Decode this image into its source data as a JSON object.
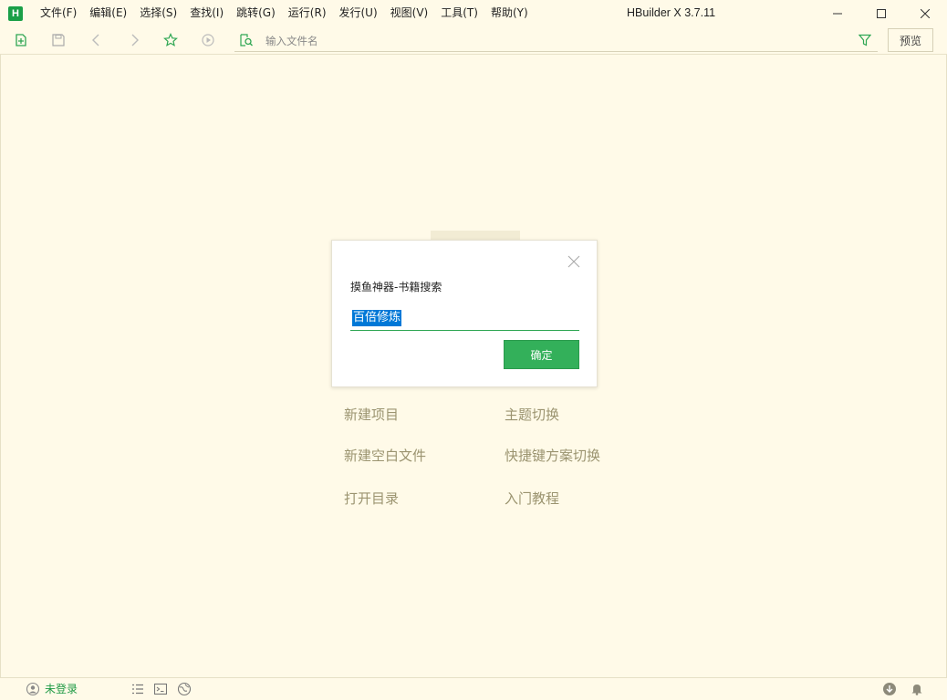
{
  "app": {
    "logo_letter": "H",
    "window_title": "HBuilder X 3.7.11"
  },
  "menu": [
    {
      "label": "文件(F)"
    },
    {
      "label": "编辑(E)"
    },
    {
      "label": "选择(S)"
    },
    {
      "label": "查找(I)"
    },
    {
      "label": "跳转(G)"
    },
    {
      "label": "运行(R)"
    },
    {
      "label": "发行(U)"
    },
    {
      "label": "视图(V)"
    },
    {
      "label": "工具(T)"
    },
    {
      "label": "帮助(Y)"
    }
  ],
  "window_controls": [
    "minimize-icon",
    "maximize-icon",
    "close-icon"
  ],
  "toolbar": {
    "icons": [
      "new-file-icon",
      "save-icon",
      "back-icon",
      "forward-icon",
      "favorite-star-icon",
      "run-icon"
    ],
    "search_placeholder": "输入文件名",
    "preview_label": "预览"
  },
  "welcome": {
    "links": [
      {
        "label": "新建项目"
      },
      {
        "label": "主题切换"
      },
      {
        "label": "新建空白文件"
      },
      {
        "label": "快捷键方案切换"
      },
      {
        "label": "打开目录"
      },
      {
        "label": "入门教程"
      }
    ]
  },
  "dialog": {
    "title": "摸鱼神器-书籍搜索",
    "input_value": "百倍修炼",
    "ok_label": "确定"
  },
  "status": {
    "login_label": "未登录",
    "icons": [
      "user-icon",
      "list-icon",
      "terminal-icon",
      "plugin-icon",
      "download-icon",
      "bell-icon"
    ]
  },
  "colors": {
    "background": "#fffae8",
    "accent_green": "#33b05a",
    "selection_blue": "#0078d7",
    "link_muted": "#9b9470"
  }
}
